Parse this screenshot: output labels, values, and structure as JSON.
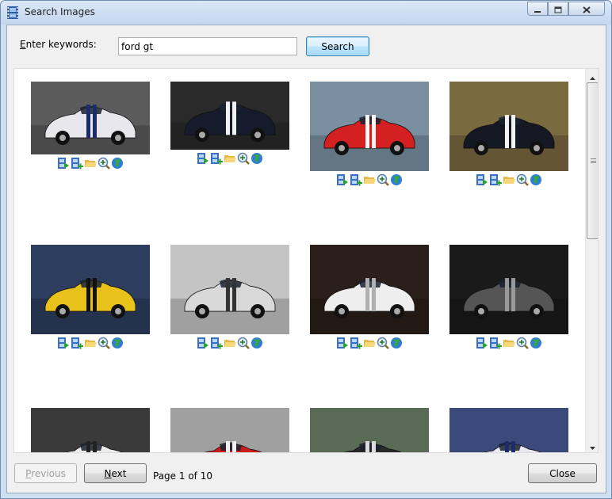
{
  "window": {
    "title": "Search Images"
  },
  "search": {
    "label": "Enter keywords:",
    "value": "ford gt",
    "button_label": "Search"
  },
  "results": {
    "items": [
      {
        "label": "ford-gt-auto-show-white-blue-stripes",
        "bg": "#5b5b5b",
        "car": "#e8e8ec",
        "stripe": "#1c2b6b"
      },
      {
        "label": "ford-gt-black-white-stripes-street",
        "bg": "#2a2a2a",
        "car": "#151b2a",
        "stripe": "#f0f0f0"
      },
      {
        "label": "ford-gt-red-white-stripes-road",
        "bg": "#7a8fa0",
        "car": "#d42020",
        "stripe": "#f5f5f5"
      },
      {
        "label": "ford-gt-black-white-stripes-driving",
        "bg": "#7a6a40",
        "car": "#141822",
        "stripe": "#f2f2f2"
      },
      {
        "label": "ford-gt-yellow-black-stripes",
        "bg": "#2e3e5e",
        "car": "#e8c21a",
        "stripe": "#111111"
      },
      {
        "label": "ford-gt-silver-rear-view",
        "bg": "#c4c4c4",
        "car": "#d9d9d9",
        "stripe": "#333333"
      },
      {
        "label": "ford-gt90-concept-white",
        "bg": "#2a1f1a",
        "car": "#eeeeee",
        "stripe": "#b0b0b0"
      },
      {
        "label": "ford-gt-interior-dashboard",
        "bg": "#1a1a1a",
        "car": "#555555",
        "stripe": "#999999"
      },
      {
        "label": "ford-gt-white-front",
        "bg": "#3a3a3a",
        "car": "#ececec",
        "stripe": "#222222"
      },
      {
        "label": "ford-gt-red-concrete-wall",
        "bg": "#a0a0a0",
        "car": "#cc1b1b",
        "stripe": "#f0f0f0"
      },
      {
        "label": "ford-gt-dark-showroom",
        "bg": "#5a6b55",
        "car": "#2a2a2a",
        "stripe": "#dddddd"
      },
      {
        "label": "ford-gt-blue-sunset",
        "bg": "#3a4a7a",
        "car": "#e9e9f0",
        "stripe": "#1c2b6b"
      }
    ],
    "action_icons": [
      "film-play-icon",
      "film-add-icon",
      "open-folder-icon",
      "zoom-in-icon",
      "globe-icon"
    ]
  },
  "pagination": {
    "previous_label": "Previous",
    "next_label": "Next",
    "page_info": "Page 1 of 10"
  },
  "footer": {
    "close_label": "Close"
  }
}
